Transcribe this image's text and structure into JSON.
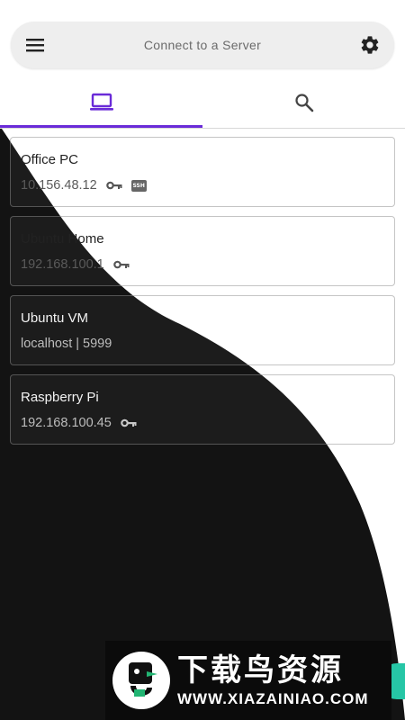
{
  "header": {
    "title": "Connect to a Server",
    "menu_icon": "hamburger-menu-icon",
    "settings_icon": "gear-icon"
  },
  "tabs": [
    {
      "icon": "laptop-icon",
      "selected": true
    },
    {
      "icon": "search-icon",
      "selected": false
    }
  ],
  "servers": [
    {
      "name": "Office PC",
      "address": "10.156.48.12",
      "has_key": true,
      "badge": "SSH"
    },
    {
      "name": "Ubuntu Home",
      "address": "192.168.100.1",
      "has_key": true,
      "badge": ""
    },
    {
      "name": "Ubuntu VM",
      "address": "localhost | 5999",
      "has_key": false,
      "badge": ""
    },
    {
      "name": "Raspberry Pi",
      "address": "192.168.100.45",
      "has_key": true,
      "badge": ""
    }
  ],
  "watermark": {
    "title": "下载鸟资源",
    "url": "WWW.XIAZAINIAO.COM"
  },
  "colors": {
    "accent": "#6a2bd8",
    "dark_background": "#131313",
    "fab": "#26c6a6"
  }
}
